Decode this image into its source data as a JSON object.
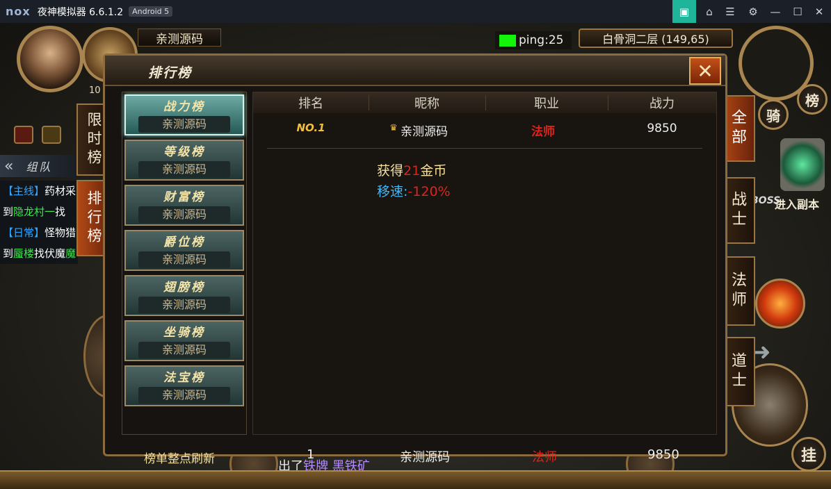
{
  "window": {
    "logo": "nox",
    "title": "夜神模拟器 6.6.1.2",
    "android": "Android 5"
  },
  "hud": {
    "player_name": "亲测源码",
    "ping": "ping:25",
    "location": "白骨洞二层 (149,65)",
    "level_partial": "10",
    "team_label": "组队",
    "quests": [
      {
        "tag": "【主线】",
        "text": "药材采",
        "line2a": "到",
        "line2b": "隐龙村一",
        "line2c": "找"
      },
      {
        "tag": "【日常】",
        "text": "怪物猎",
        "line2a": "到",
        "line2b": "蜃楼",
        "line2c": "找伏魔"
      }
    ],
    "left_tabs": [
      "限时榜",
      "排行榜"
    ],
    "right_tabs": [
      "全部",
      "战士",
      "法师",
      "道士"
    ],
    "buttons": {
      "rank": "榜",
      "ride": "骑",
      "auto": "挂"
    },
    "enter_dungeon": "进入副本",
    "boss": "BOSS",
    "bottom": {
      "prefix": "出了",
      "item1": "铁牌",
      "item2": "黑铁矿"
    }
  },
  "panel": {
    "title": "排行榜",
    "close": "✕",
    "categories": [
      {
        "title": "战力榜",
        "sub": "亲测源码"
      },
      {
        "title": "等级榜",
        "sub": "亲测源码"
      },
      {
        "title": "财富榜",
        "sub": "亲测源码"
      },
      {
        "title": "爵位榜",
        "sub": "亲测源码"
      },
      {
        "title": "翅膀榜",
        "sub": "亲测源码"
      },
      {
        "title": "坐骑榜",
        "sub": "亲测源码"
      },
      {
        "title": "法宝榜",
        "sub": "亲测源码"
      }
    ],
    "columns": [
      "排名",
      "昵称",
      "职业",
      "战力"
    ],
    "row": {
      "rank": "NO.1",
      "name": "亲测源码",
      "crown": "♛",
      "job": "法师",
      "power": "9850"
    },
    "reward": {
      "prefix": "获得",
      "amount": "21",
      "suffix": "金币",
      "speed_label": "移速:",
      "speed_value": "-120%"
    },
    "footer": {
      "note": "榜单整点刷新",
      "rank": "1",
      "name": "亲测源码",
      "job": "法师",
      "power": "9850"
    }
  },
  "colors": {
    "accent": "#1fb59b",
    "job": "#e0231c",
    "gold": "#f5e0a0"
  }
}
